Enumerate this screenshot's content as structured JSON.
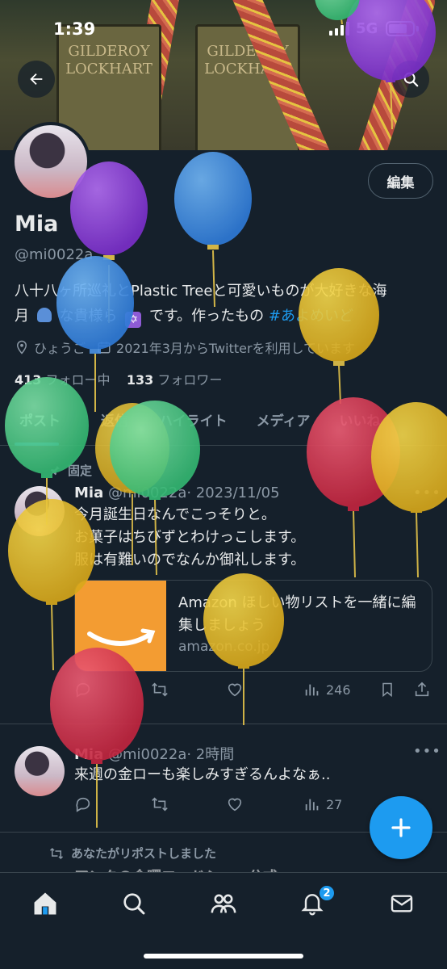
{
  "status": {
    "time": "1:39",
    "network": "5G"
  },
  "banner": {
    "book_left": "GILDEROY\nLOCKHART",
    "book_right": "GILDEROY\nLOCKHART"
  },
  "profile": {
    "edit_label": "編集",
    "name": "Mia",
    "handle": "@mi0022a",
    "bio_line1": "八十八ヶ所巡礼とPlastic Treeと可愛いものが大好きな海",
    "bio_line2_pre": "月",
    "bio_line2_mid": "な貴様ら",
    "bio_line2_post": "です。作ったもの",
    "bio_hashtag": "#あよめいど",
    "location": "ひょうご",
    "joined": "2021年3月からTwitterを利用しています",
    "following_count": "413",
    "following_label": "フォロー中",
    "followers_count": "133",
    "followers_label": "フォロワー"
  },
  "tabs": [
    "ポスト",
    "返信",
    "ハイライト",
    "メディア",
    "いいね"
  ],
  "tweets": [
    {
      "context": "固定",
      "name": "Mia",
      "handle": "@mi0022a",
      "time": "· 2023/11/05",
      "lines": [
        "今月誕生日なんでこっそりと。",
        "お菓子はちびずとわけっこします。",
        "服は有難いのでなんか御礼します。"
      ],
      "card_title": "Amazon ほしい物リストを一緒に編集しましょう",
      "card_domain": "amazon.co.jp",
      "views": "246"
    },
    {
      "name": "Mia",
      "handle": "@mi0022a",
      "time": "· 2時間",
      "lines": [
        "来週の金ローも楽しみすぎるんよなぁ.."
      ],
      "views": "27"
    }
  ],
  "retweet_context": "あなたがリポストしました",
  "retweet_preview": "アンクの金曜ロードショー公式",
  "nav": {
    "notifications_badge": "2"
  },
  "icons": [
    "back-arrow-icon",
    "search-icon",
    "location-pin-icon",
    "calendar-icon",
    "pin-icon",
    "reply-icon",
    "repost-icon",
    "like-icon",
    "views-icon",
    "bookmark-icon",
    "share-icon",
    "plus-icon",
    "home-icon",
    "explore-icon",
    "communities-icon",
    "bell-icon",
    "mail-icon"
  ],
  "colors": {
    "background": "#15202b",
    "accent": "#1d9bf0",
    "muted": "#8b98a5",
    "border": "#38444d"
  }
}
